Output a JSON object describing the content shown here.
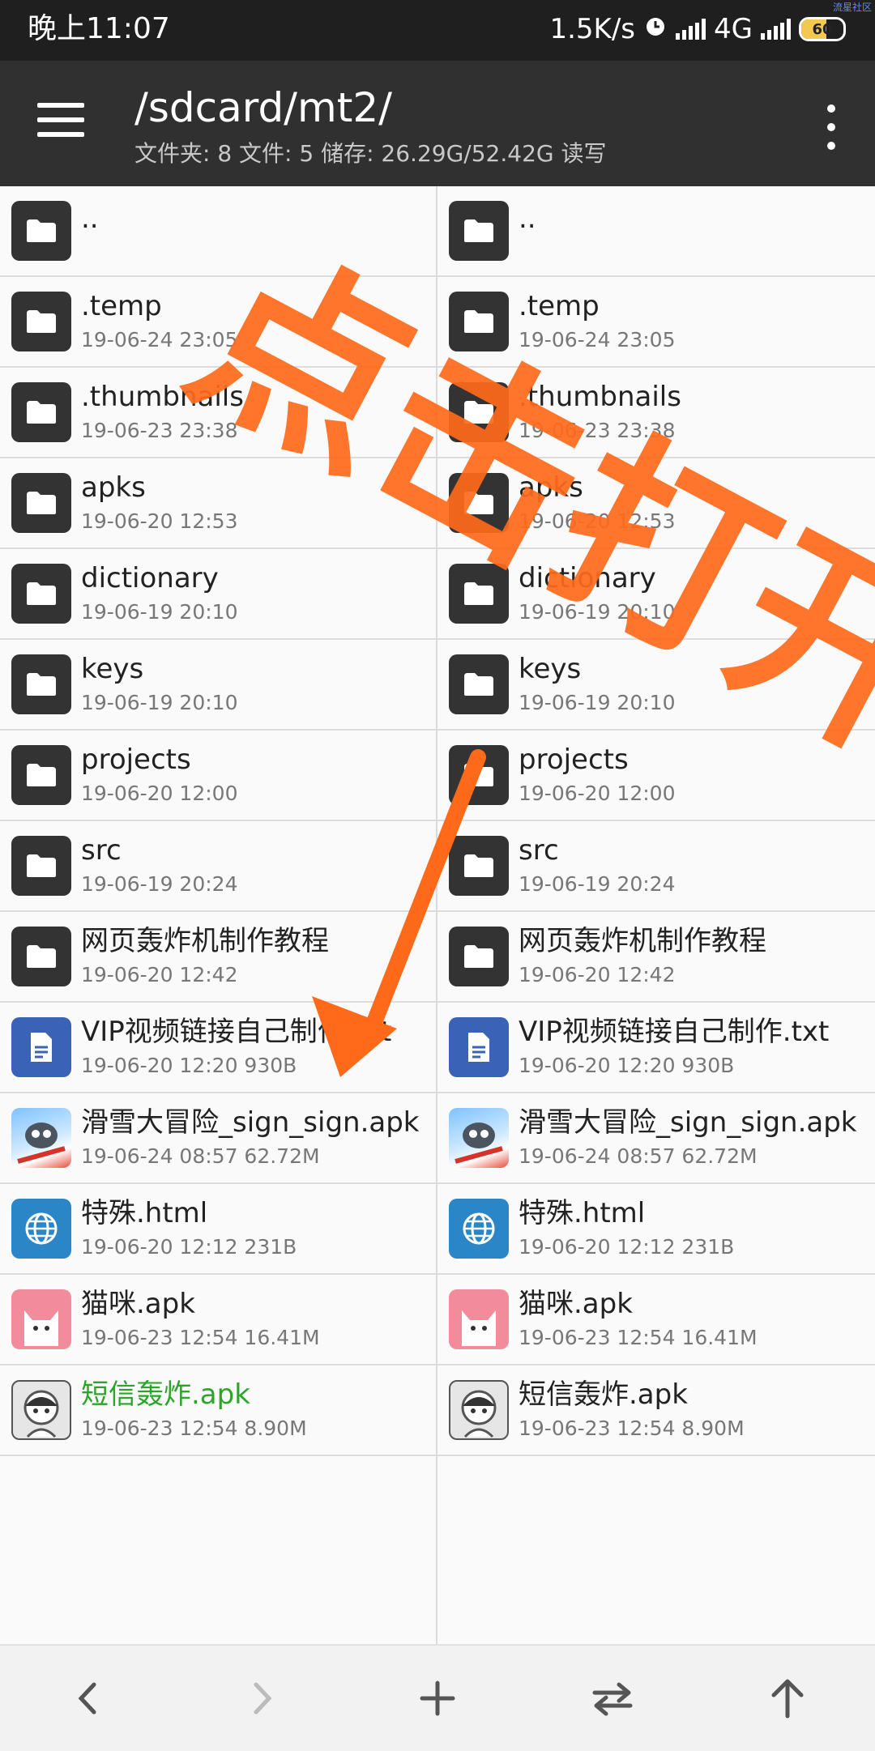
{
  "status": {
    "time": "晚上11:07",
    "speed": "1.5K/s",
    "network": "4G",
    "battery": "60",
    "watermark": "流星社区"
  },
  "toolbar": {
    "path": "/sdcard/mt2/",
    "summary": "文件夹: 8  文件: 5  储存: 26.29G/52.42G  读写"
  },
  "left_pane": {
    "items": [
      {
        "name": "..",
        "meta": "",
        "type": "folder"
      },
      {
        "name": ".temp",
        "meta": "19-06-24 23:05",
        "type": "folder"
      },
      {
        "name": ".thumbnails",
        "meta": "19-06-23 23:38",
        "type": "folder"
      },
      {
        "name": "apks",
        "meta": "19-06-20 12:53",
        "type": "folder"
      },
      {
        "name": "dictionary",
        "meta": "19-06-19 20:10",
        "type": "folder"
      },
      {
        "name": "keys",
        "meta": "19-06-19 20:10",
        "type": "folder"
      },
      {
        "name": "projects",
        "meta": "19-06-20 12:00",
        "type": "folder"
      },
      {
        "name": "src",
        "meta": "19-06-19 20:24",
        "type": "folder"
      },
      {
        "name": "网页轰炸机制作教程",
        "meta": "19-06-20 12:42",
        "type": "folder"
      },
      {
        "name": "VIP视频链接自己制作.txt",
        "meta": "19-06-20 12:20  930B",
        "type": "txt"
      },
      {
        "name": "滑雪大冒险_sign_sign.apk",
        "meta": "19-06-24 08:57  62.72M",
        "type": "ski"
      },
      {
        "name": "特殊.html",
        "meta": "19-06-20 12:12  231B",
        "type": "html"
      },
      {
        "name": "猫咪.apk",
        "meta": "19-06-23 12:54  16.41M",
        "type": "cat"
      },
      {
        "name": "短信轰炸.apk",
        "meta": "19-06-23 12:54  8.90M",
        "type": "sms",
        "highlight": "#2aa52a"
      }
    ]
  },
  "right_pane": {
    "items": [
      {
        "name": "..",
        "meta": "",
        "type": "folder"
      },
      {
        "name": ".temp",
        "meta": "19-06-24 23:05",
        "type": "folder"
      },
      {
        "name": ".thumbnails",
        "meta": "19-06-23 23:38",
        "type": "folder"
      },
      {
        "name": "apks",
        "meta": "19-06-20 12:53",
        "type": "folder"
      },
      {
        "name": "dictionary",
        "meta": "19-06-19 20:10",
        "type": "folder"
      },
      {
        "name": "keys",
        "meta": "19-06-19 20:10",
        "type": "folder"
      },
      {
        "name": "projects",
        "meta": "19-06-20 12:00",
        "type": "folder"
      },
      {
        "name": "src",
        "meta": "19-06-19 20:24",
        "type": "folder"
      },
      {
        "name": "网页轰炸机制作教程",
        "meta": "19-06-20 12:42",
        "type": "folder"
      },
      {
        "name": "VIP视频链接自己制作.txt",
        "meta": "19-06-20 12:20  930B",
        "type": "txt"
      },
      {
        "name": "滑雪大冒险_sign_sign.apk",
        "meta": "19-06-24 08:57  62.72M",
        "type": "ski"
      },
      {
        "name": "特殊.html",
        "meta": "19-06-20 12:12  231B",
        "type": "html"
      },
      {
        "name": "猫咪.apk",
        "meta": "19-06-23 12:54  16.41M",
        "type": "cat"
      },
      {
        "name": "短信轰炸.apk",
        "meta": "19-06-23 12:54  8.90M",
        "type": "sms"
      }
    ]
  },
  "annotation": {
    "text": "点击打开",
    "color": "#ff6a1a"
  },
  "bottom_bar": {
    "buttons": [
      "back-icon",
      "forward-icon",
      "add-icon",
      "swap-icon",
      "up-icon"
    ]
  },
  "colors": {
    "toolbar": "#303030",
    "statusbar": "#1f1f1f",
    "highlight_green": "#2aa52a"
  }
}
